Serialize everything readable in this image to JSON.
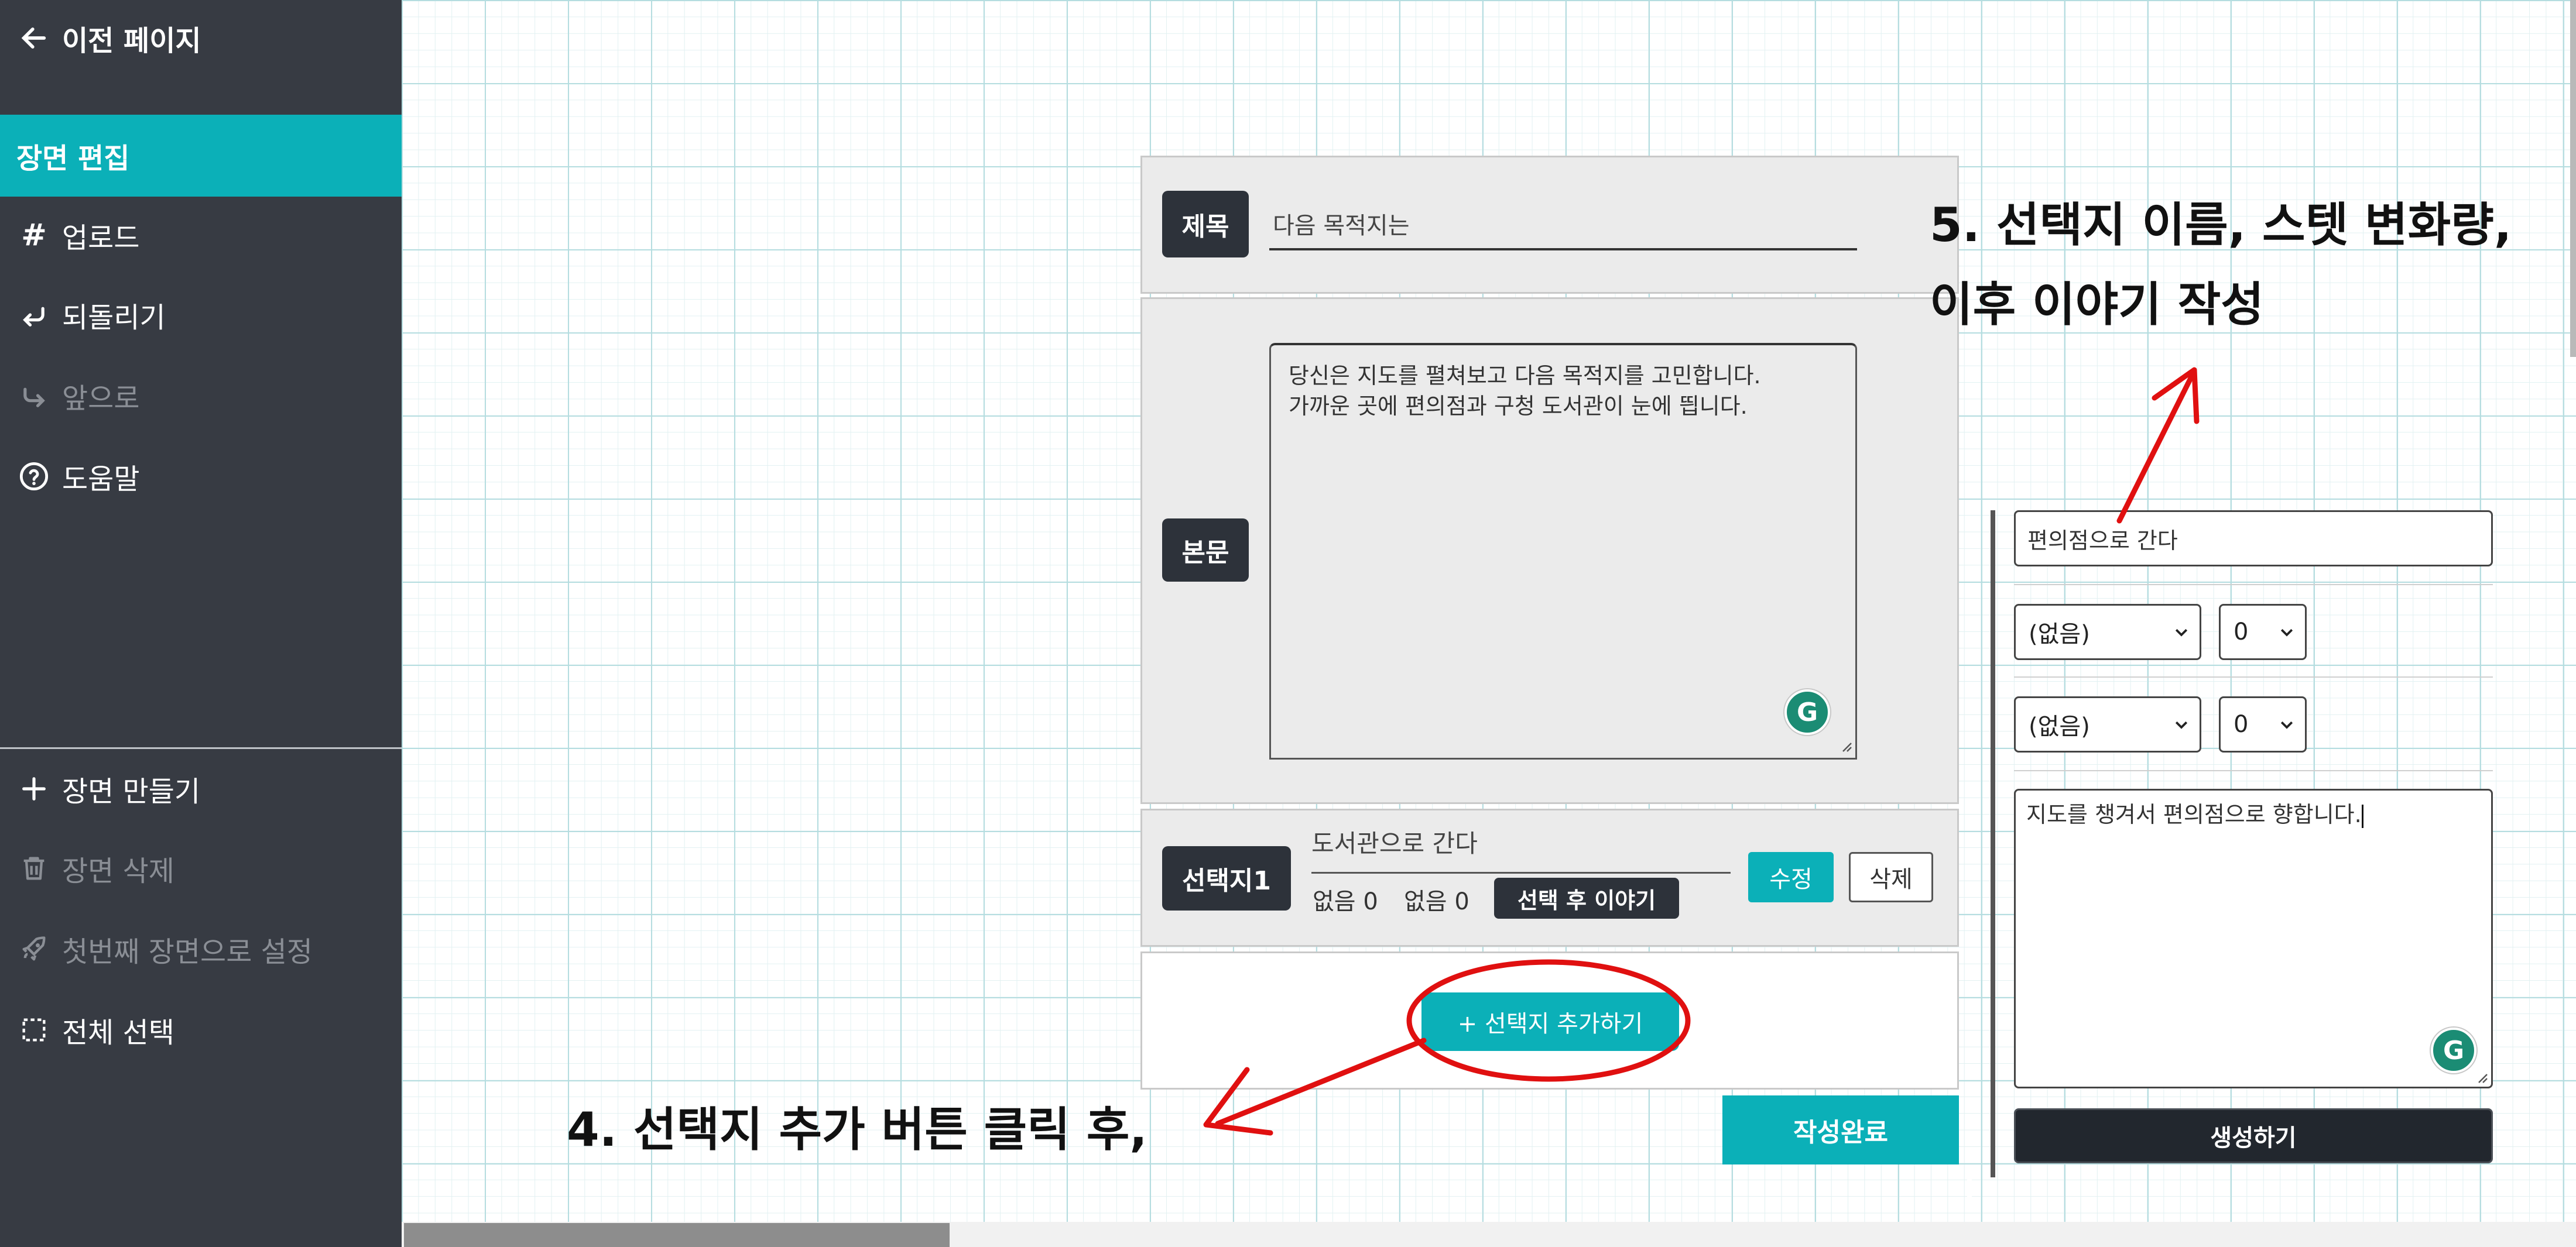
{
  "sidebar": {
    "back_label": "이전 페이지",
    "active_label": "장면 편집",
    "items": [
      {
        "label": "업로드",
        "icon": "hash-icon",
        "enabled": true
      },
      {
        "label": "되돌리기",
        "icon": "undo-icon",
        "enabled": true
      },
      {
        "label": "앞으로",
        "icon": "redo-icon",
        "enabled": false
      },
      {
        "label": "도움말",
        "icon": "help-icon",
        "enabled": true
      }
    ],
    "bottom_items": [
      {
        "label": "장면 만들기",
        "icon": "plus-icon",
        "enabled": true
      },
      {
        "label": "장면 삭제",
        "icon": "trash-icon",
        "enabled": false
      },
      {
        "label": "첫번째 장면으로 설정",
        "icon": "rocket-icon",
        "enabled": false
      },
      {
        "label": "전체 선택",
        "icon": "select-all-icon",
        "enabled": true
      }
    ]
  },
  "scene": {
    "title_tag": "제목",
    "title_value": "다음 목적지는",
    "body_tag": "본문",
    "body_text": "당신은 지도를 펼쳐보고 다음 목적지를 고민합니다.\n가까운 곳에 편의점과 구청 도서관이 눈에 띕니다.",
    "choice_tag": "선택지1",
    "choice": {
      "name": "도서관으로 간다",
      "stat1": "없음 0",
      "stat2": "없음 0",
      "after_story_badge": "선택 후 이야기",
      "edit_label": "수정",
      "delete_label": "삭제"
    },
    "add_choice_label": "+ 선택지 추가하기",
    "complete_label": "작성완료"
  },
  "choice_editor": {
    "name_value": "편의점으로 간다",
    "stat_rows": [
      {
        "stat": "(없음)",
        "amount": "0"
      },
      {
        "stat": "(없음)",
        "amount": "0"
      }
    ],
    "story_text": "지도를 챙겨서 편의점으로 향합니다.",
    "generate_label": "생성하기"
  },
  "annotations": {
    "step4": "4. 선택지 추가 버튼 클릭 후,",
    "step5_line1": "5. 선택지 이름, 스텟 변화량,",
    "step5_line2": "이후 이야기 작성"
  },
  "colors": {
    "accent": "#0bb0b8",
    "sidebar_bg": "#373b43",
    "tag_bg": "#2d323a",
    "annotation": "#e01010"
  }
}
